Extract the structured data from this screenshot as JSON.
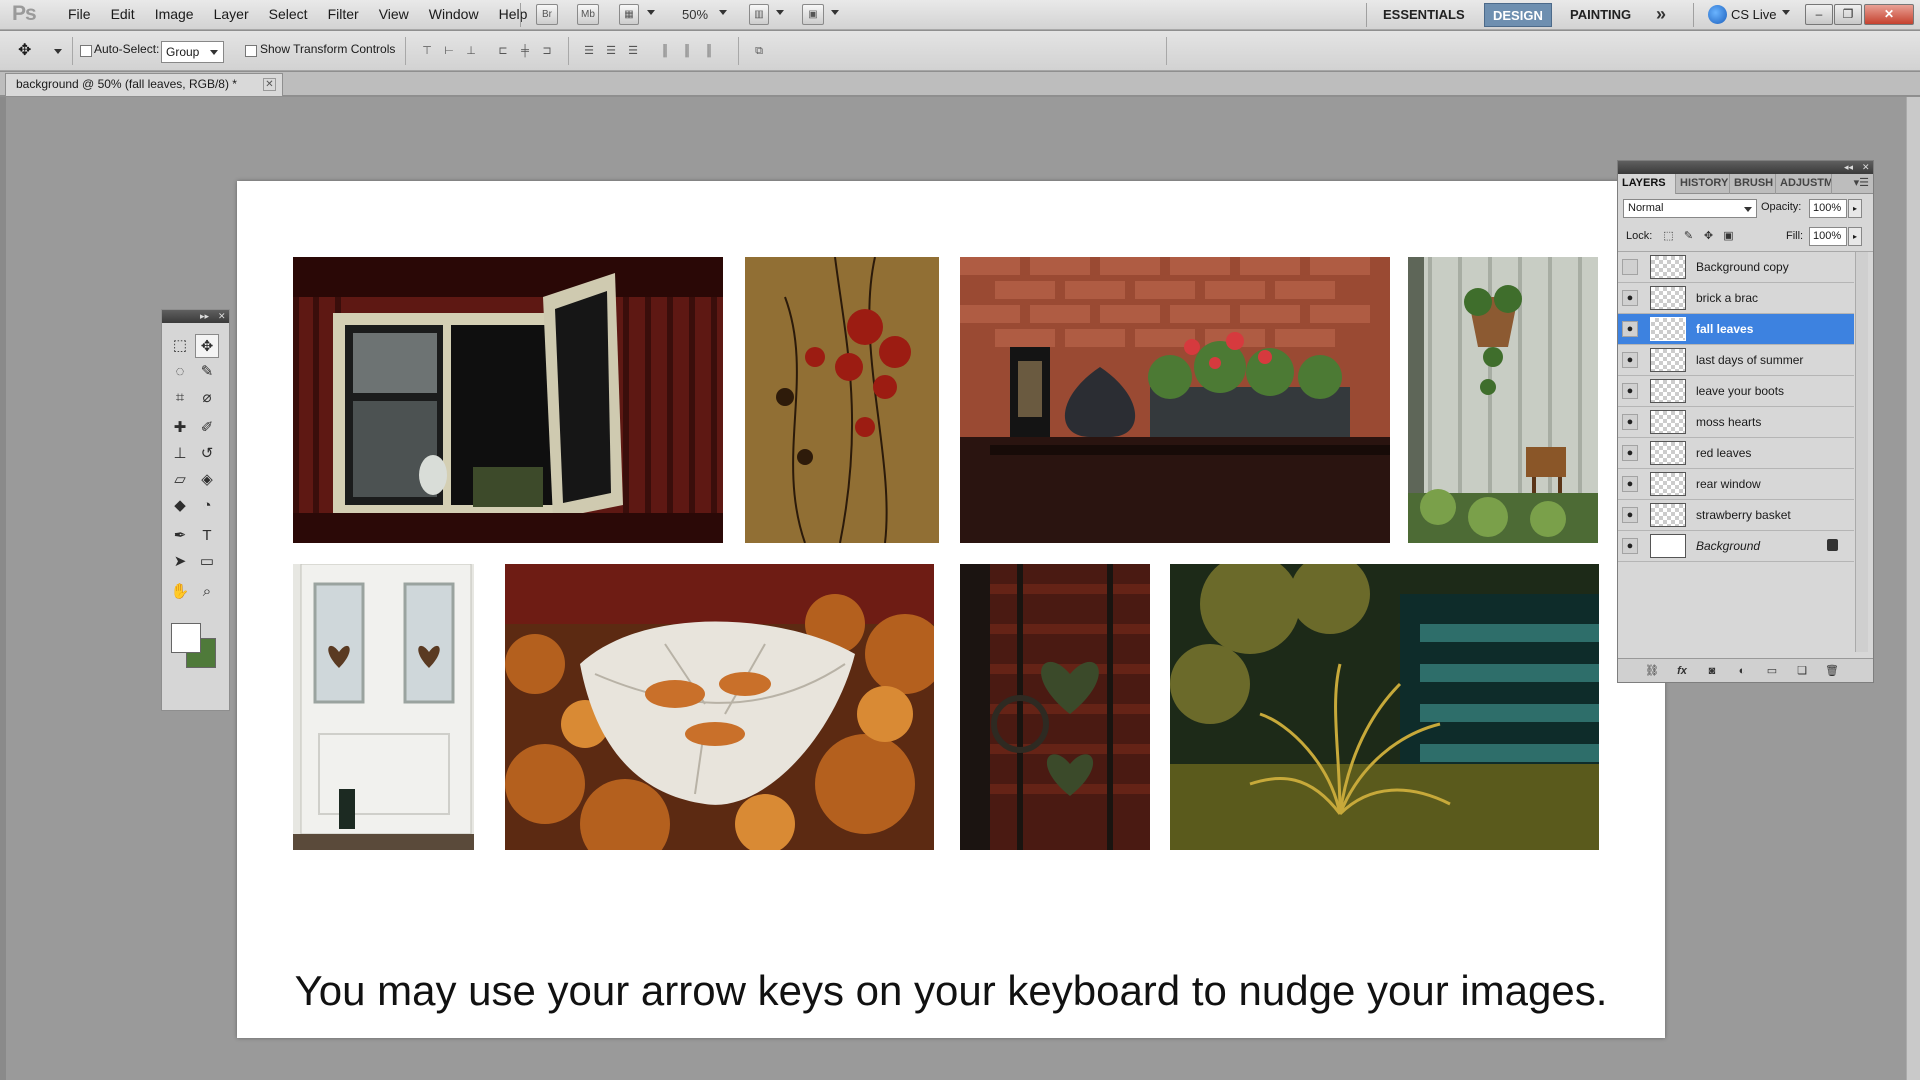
{
  "app": {
    "logo": "Ps"
  },
  "menu": [
    "File",
    "Edit",
    "Image",
    "Layer",
    "Select",
    "Filter",
    "View",
    "Window",
    "Help"
  ],
  "menubar_icons": {
    "bridge": "Br",
    "minibridge": "Mb"
  },
  "zoom": "50%",
  "workspaces": {
    "essentials": "ESSENTIALS",
    "design": "DESIGN",
    "painting": "PAINTING"
  },
  "cs_live": "CS Live",
  "options": {
    "auto_select_label": "Auto-Select:",
    "auto_select_value": "Group",
    "show_transform_label": "Show Transform Controls"
  },
  "document": {
    "tab_title": "background @ 50% (fall leaves, RGB/8) *"
  },
  "canvas": {
    "caption": "You may use your arrow keys on your keyboard to nudge your images."
  },
  "layers_panel": {
    "tabs": [
      "LAYERS",
      "HISTORY",
      "BRUSH",
      "ADJUSTMENTS"
    ],
    "blend_mode": "Normal",
    "opacity_label": "Opacity:",
    "opacity": "100%",
    "lock_label": "Lock:",
    "fill_label": "Fill:",
    "fill": "100%",
    "layers": [
      {
        "name": "Background copy",
        "visible": false,
        "selected": false
      },
      {
        "name": "brick a brac",
        "visible": true,
        "selected": false
      },
      {
        "name": "fall leaves",
        "visible": true,
        "selected": true
      },
      {
        "name": "last days of summer",
        "visible": true,
        "selected": false
      },
      {
        "name": "leave your boots",
        "visible": true,
        "selected": false
      },
      {
        "name": "moss hearts",
        "visible": true,
        "selected": false
      },
      {
        "name": "red leaves",
        "visible": true,
        "selected": false
      },
      {
        "name": "rear window",
        "visible": true,
        "selected": false
      },
      {
        "name": "strawberry basket",
        "visible": true,
        "selected": false
      },
      {
        "name": "Background",
        "visible": true,
        "selected": false,
        "locked": true
      }
    ]
  },
  "colors": {
    "selection_blue": "#3d82e0",
    "workspace_active": "#6e8fb0",
    "foreground": "#ffffff",
    "background": "#4f7a3a"
  }
}
